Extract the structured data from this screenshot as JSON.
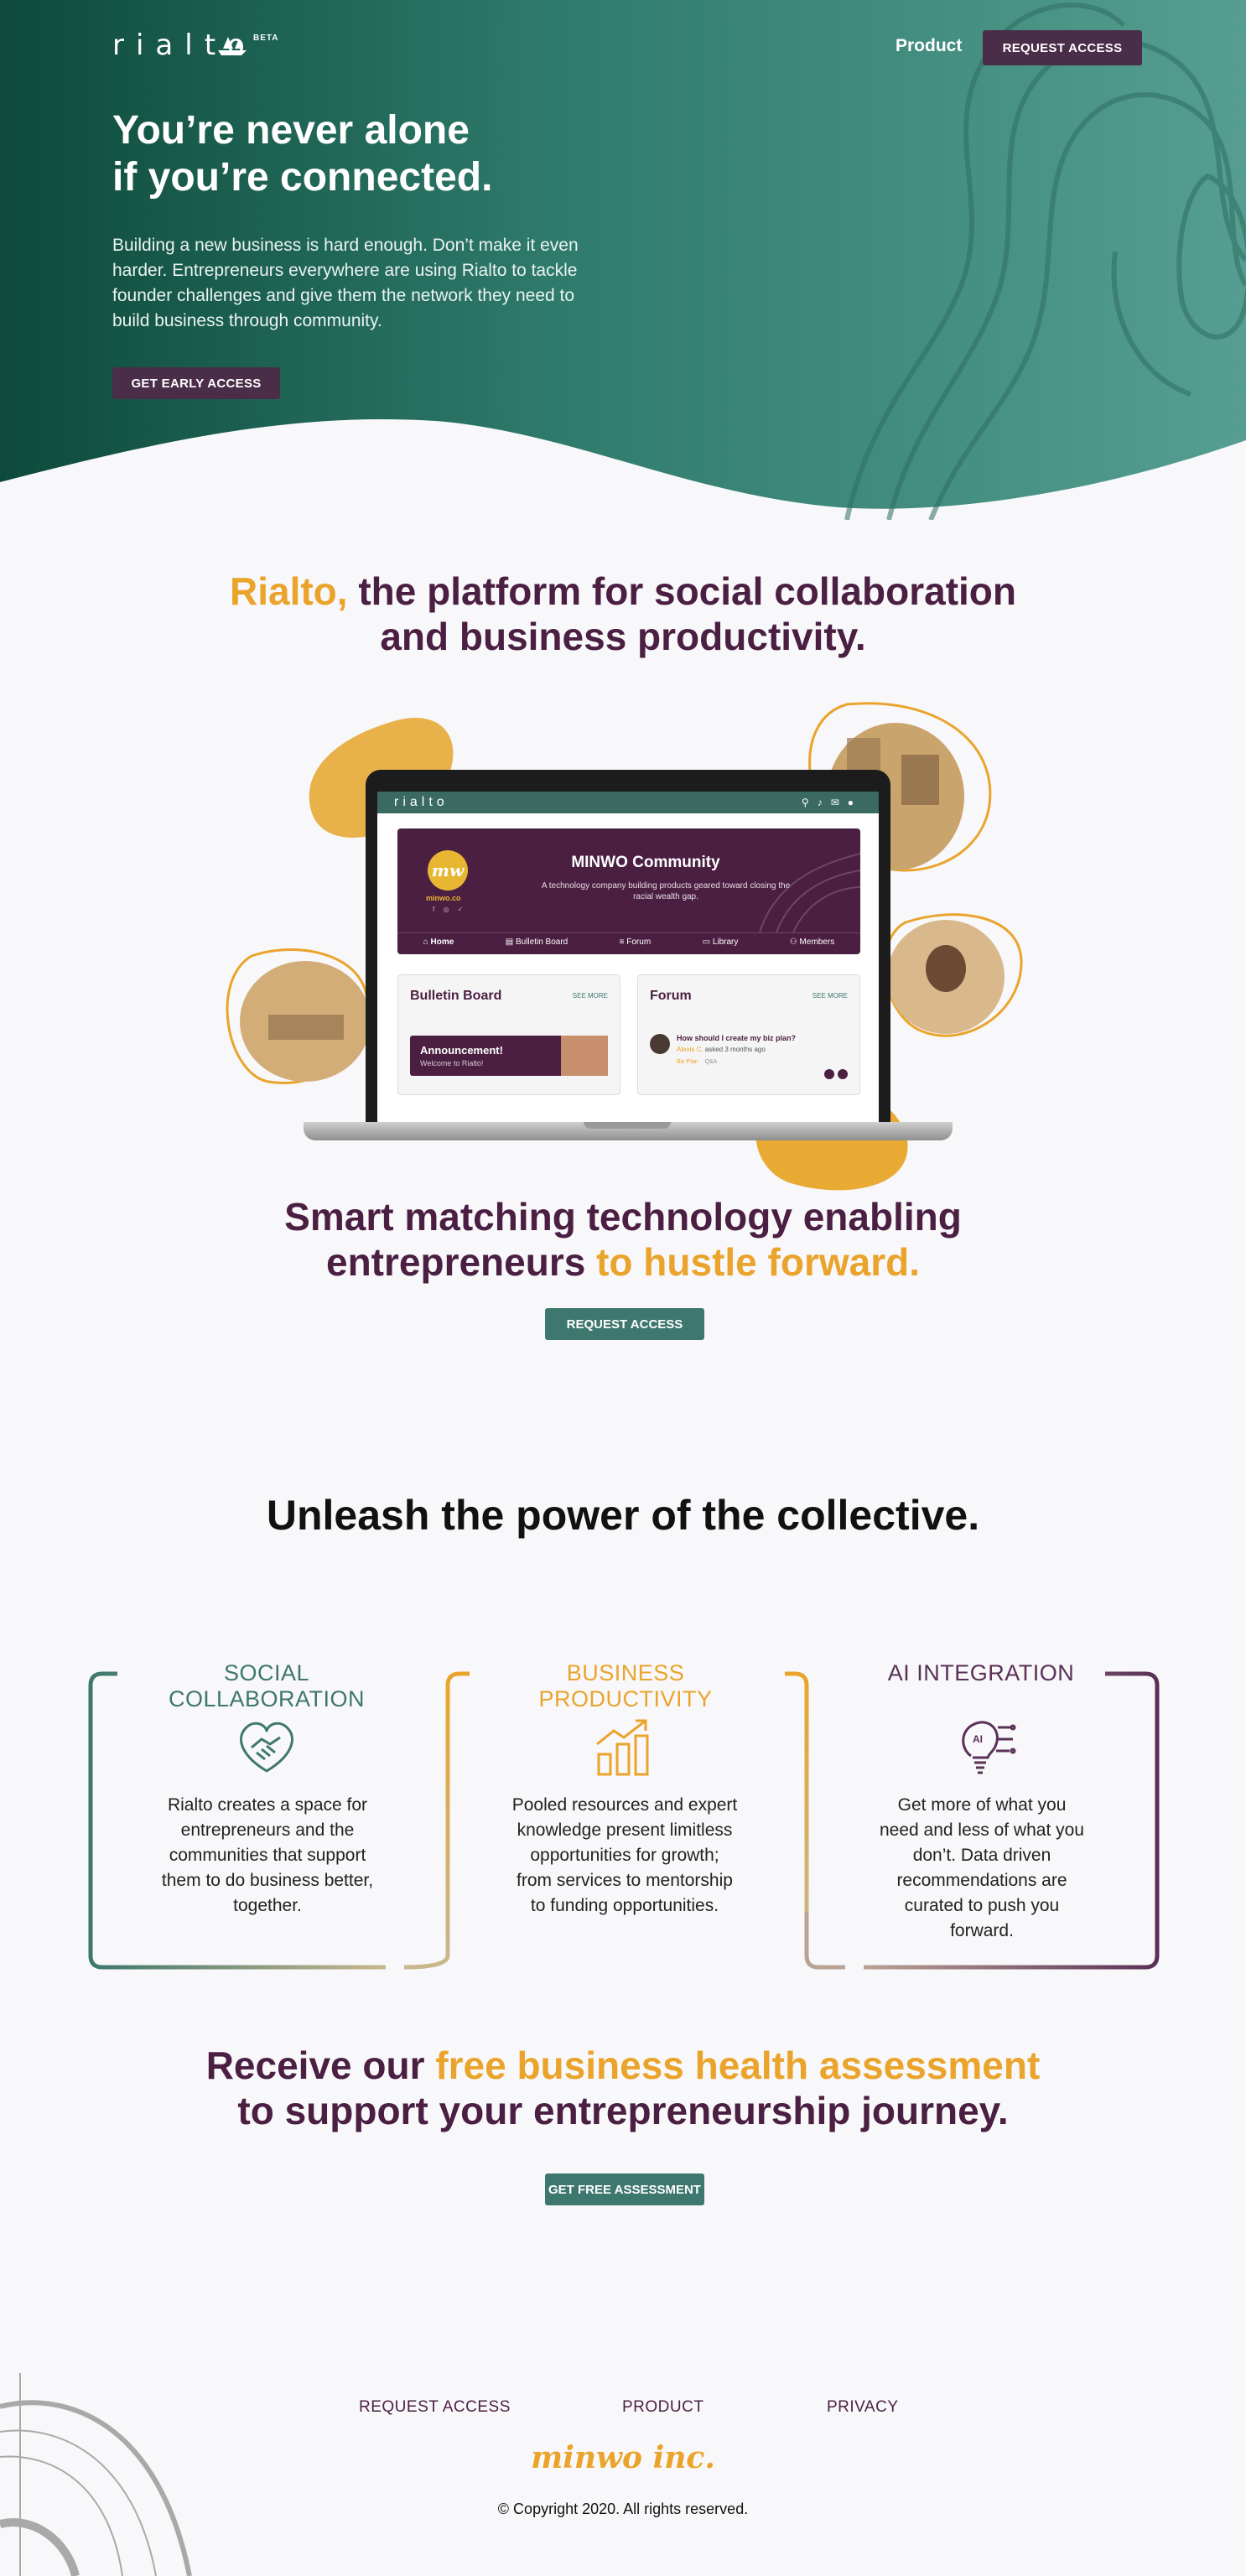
{
  "header": {
    "logo": "rialto",
    "beta_badge": "BETA",
    "nav_product": "Product",
    "request_access": "REQUEST ACCESS"
  },
  "hero": {
    "title_line1": "You’re never alone",
    "title_line2": "if you’re connected.",
    "description": "Building a new business is hard enough. Don’t make it even harder. Entrepreneurs everywhere are using Rialto to tackle founder challenges and give them the network they need to build business through community.",
    "cta": "GET EARLY ACCESS"
  },
  "platform": {
    "title_highlight": "Rialto,",
    "title_rest_line1": " the platform for social collaboration",
    "title_line2": "and business productivity."
  },
  "mockup": {
    "app_logo": "rialto",
    "community_logo": "mw",
    "community_url": "minwo.co",
    "community_title": "MINWO Community",
    "community_sub": "A technology company building products geared toward closing the racial wealth gap.",
    "tabs": [
      "Home",
      "Bulletin Board",
      "Forum",
      "Library",
      "Members"
    ],
    "bulletin_title": "Bulletin Board",
    "bulletin_see_more": "SEE MORE",
    "announcement_title": "Announcement!",
    "announcement_text": "Welcome to Rialto!",
    "forum_title": "Forum",
    "forum_see_more": "SEE MORE",
    "forum_post_title": "How should I create my biz plan?",
    "forum_post_meta_author": "Alexis C.",
    "forum_post_meta_rest": " asked 3 months ago",
    "forum_tags": [
      "Biz Plan",
      "Q&A"
    ]
  },
  "matching": {
    "line1": "Smart matching technology enabling",
    "line2_plain": "entrepreneurs ",
    "line2_highlight": "to hustle forward.",
    "cta": "REQUEST ACCESS"
  },
  "power": {
    "title": "Unleash the power of the collective."
  },
  "features": [
    {
      "title": "SOCIAL COLLABORATION",
      "text": "Rialto creates a space for entrepreneurs and the communities that support them to do business better, together.",
      "icon": "handshake-icon",
      "color": "#3e776d"
    },
    {
      "title": "BUSINESS PRODUCTIVITY",
      "text": "Pooled resources and expert knowledge present limitless opportunities for growth; from services to mentorship to funding opportunities.",
      "icon": "growth-chart-icon",
      "color": "#eaa42b"
    },
    {
      "title": "AI INTEGRATION",
      "text": "Get more of what you need and less of what you don’t. Data driven recommendations are curated to push you forward.",
      "icon": "ai-bulb-icon",
      "color": "#5a3057"
    }
  ],
  "assessment": {
    "line1_plain": "Receive our ",
    "line1_highlight": "free business health assessment",
    "line2": "to support your entrepreneurship journey.",
    "cta": "GET FREE ASSESSMENT"
  },
  "footer": {
    "links": [
      "REQUEST ACCESS",
      "PRODUCT",
      "PRIVACY"
    ],
    "logo": "minwo inc.",
    "copyright": "© Copyright 2020. All rights reserved."
  },
  "colors": {
    "hero_dark": "#0f4d3f",
    "hero_light": "#4e9a8c",
    "purple": "#4b1f42",
    "orange": "#eaa42b",
    "green": "#3e776d"
  }
}
